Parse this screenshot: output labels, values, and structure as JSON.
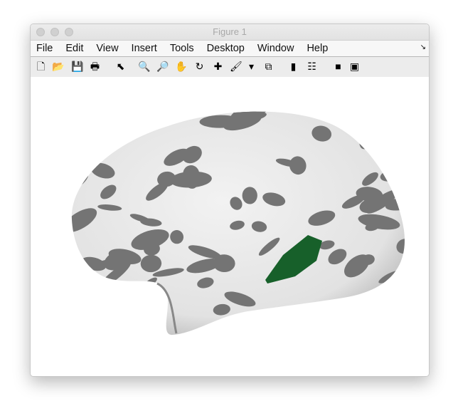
{
  "window": {
    "title": "Figure 1"
  },
  "menu": [
    "File",
    "Edit",
    "View",
    "Insert",
    "Tools",
    "Desktop",
    "Window",
    "Help"
  ],
  "toolbar": [
    {
      "name": "new-figure-icon",
      "glyph": "🗋"
    },
    {
      "name": "open-file-icon",
      "glyph": "📂"
    },
    {
      "name": "save-icon",
      "glyph": "💾"
    },
    {
      "name": "print-icon",
      "glyph": "🖶"
    },
    {
      "name": "edit-plot-arrow-icon",
      "glyph": "⬉"
    },
    {
      "name": "zoom-in-icon",
      "glyph": "🔍"
    },
    {
      "name": "zoom-out-icon",
      "glyph": "🔎"
    },
    {
      "name": "pan-hand-icon",
      "glyph": "✋"
    },
    {
      "name": "rotate-3d-icon",
      "glyph": "↻"
    },
    {
      "name": "data-cursor-icon",
      "glyph": "✚"
    },
    {
      "name": "brush-icon",
      "glyph": "🖌"
    },
    {
      "name": "brush-dropdown-icon",
      "glyph": "▾"
    },
    {
      "name": "link-plot-icon",
      "glyph": "⧉"
    },
    {
      "name": "colorbar-icon",
      "glyph": "▮"
    },
    {
      "name": "legend-icon",
      "glyph": "☷"
    },
    {
      "name": "hide-plot-tools-icon",
      "glyph": "■"
    },
    {
      "name": "show-plot-tools-icon",
      "glyph": "▣"
    }
  ],
  "colors": {
    "surface_light": "#e9e9e9",
    "surface_dark": "#707070",
    "highlight_region": "#17602a"
  }
}
